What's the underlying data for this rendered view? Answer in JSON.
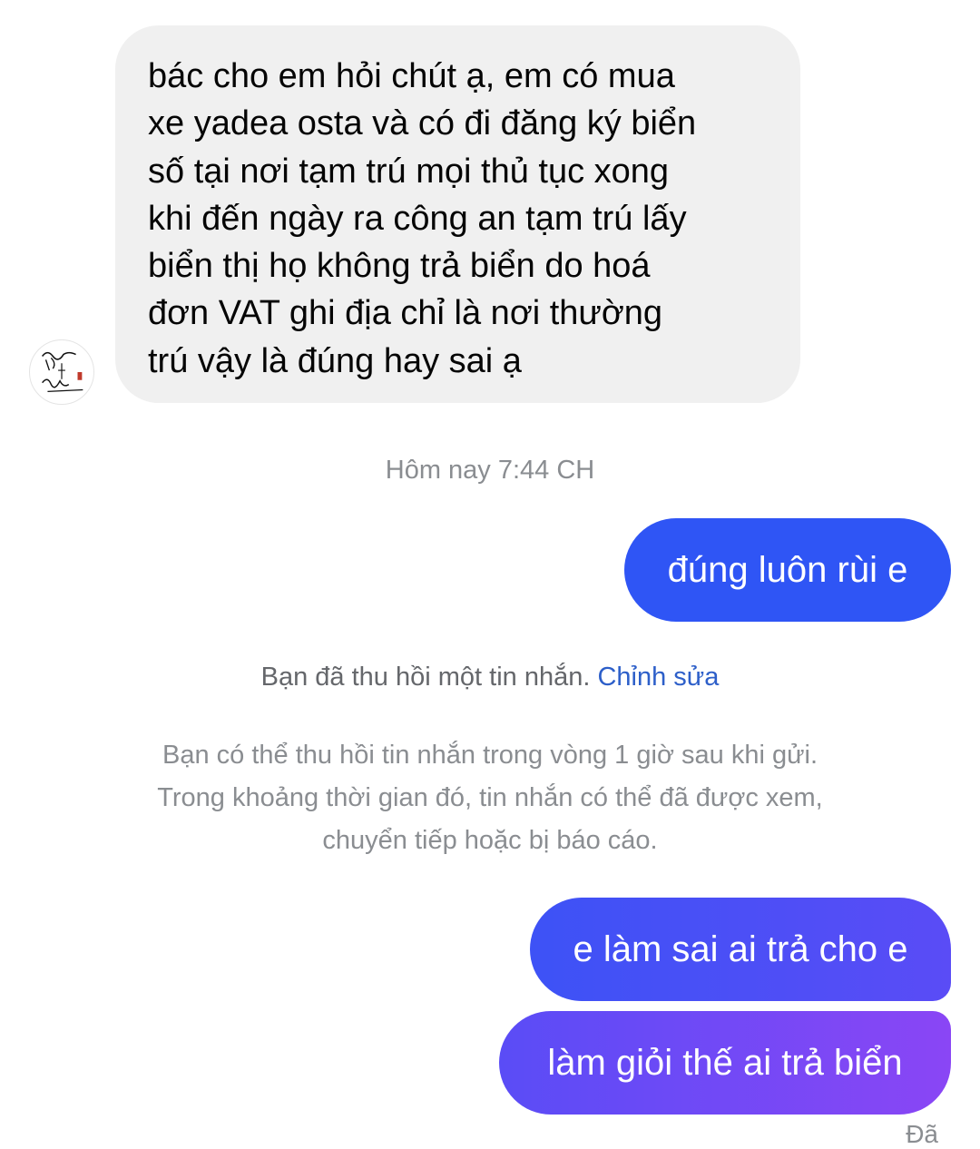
{
  "conversation": {
    "incoming": {
      "avatar_icon": "calligraphy-avatar-icon",
      "text": "bác cho em hỏi chút ạ, em có mua\nxe yadea osta và có đi đăng ký biển\nsố tại nơi tạm trú mọi thủ tục xong\nkhi đến ngày ra công an tạm trú lấy\nbiển thị họ không trả biển do hoá\nđơn VAT ghi địa chỉ là nơi thường\ntrú vậy là đúng hay sai ạ"
    },
    "timestamp": "Hôm nay 7:44 CH",
    "outgoing": [
      {
        "text": "đúng luôn rùi e"
      },
      {
        "text": "e làm sai ai trả cho e"
      },
      {
        "text": "làm giỏi thế ai trả biển"
      }
    ],
    "recall_notice": {
      "text": "Bạn đã thu hồi một tin nhắn.",
      "edit_label": "Chỉnh sửa"
    },
    "recall_info": [
      "Bạn có thể thu hồi tin nhắn trong vòng 1 giờ sau khi gửi.",
      "Trong khoảng thời gian đó, tin nhắn có thể đã được xem,",
      "chuyển tiếp hoặc bị báo cáo."
    ],
    "seen_status": "Đã"
  },
  "colors": {
    "incoming_bubble": "#f0f0f0",
    "outgoing_blue": "#2f55f5",
    "outgoing_gradient_end": "#8a46f5",
    "link": "#2d5fc9"
  }
}
